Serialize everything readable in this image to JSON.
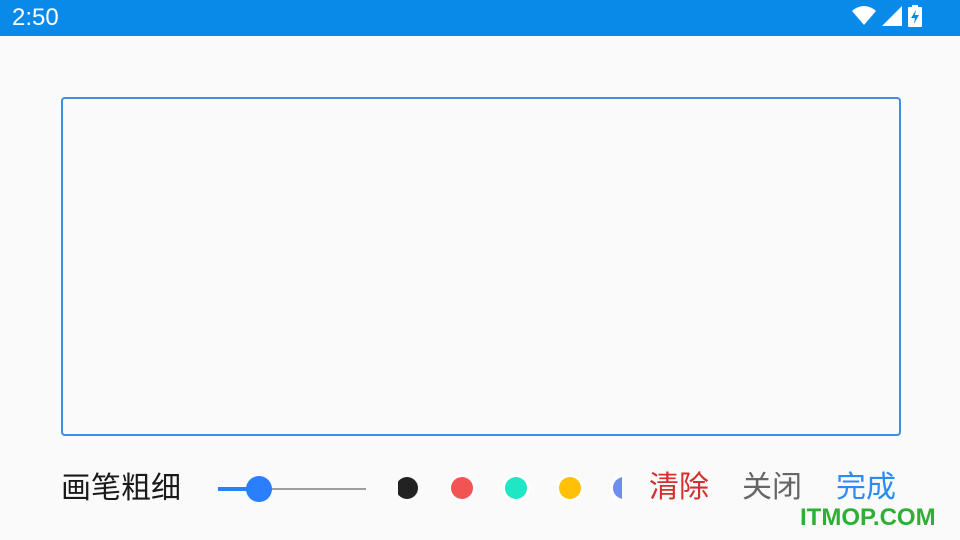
{
  "status_bar": {
    "time": "2:50",
    "background": "#0a8ae8",
    "icons": [
      "wifi-icon",
      "signal-icon",
      "battery-charging-icon"
    ]
  },
  "drawing_area": {
    "border_color": "#3d8fe0"
  },
  "controls": {
    "thickness_label": "画笔粗细",
    "thickness_level": 0.28,
    "accent": "#2a7fff",
    "colors": [
      {
        "name": "black",
        "hex": "#222222"
      },
      {
        "name": "red",
        "hex": "#f25353"
      },
      {
        "name": "teal",
        "hex": "#1fe6c4"
      },
      {
        "name": "yellow",
        "hex": "#ffc107"
      },
      {
        "name": "blue",
        "hex": "#6f8cf0"
      }
    ],
    "clear_label": "清除",
    "clear_color": "#d32f2f",
    "close_label": "关闭",
    "close_color": "#666666",
    "done_label": "完成",
    "done_color": "#2a8bf0"
  },
  "watermark": {
    "text": "ITMOP.COM",
    "color": "#2fb034"
  }
}
